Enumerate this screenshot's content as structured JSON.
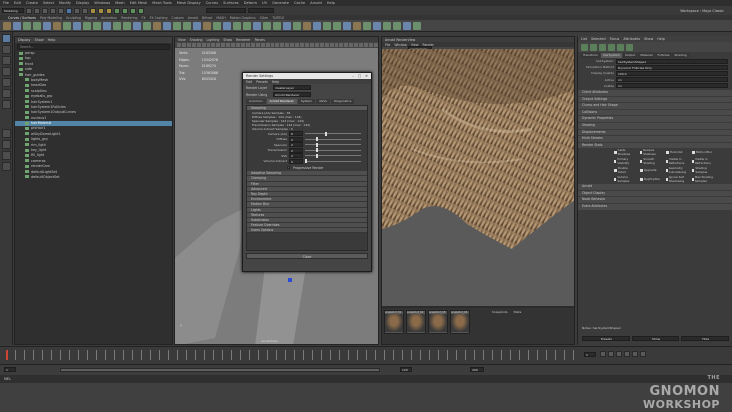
{
  "menubar": [
    "File",
    "Edit",
    "Create",
    "Select",
    "Modify",
    "Display",
    "Windows",
    "Mesh",
    "Edit Mesh",
    "Mesh Tools",
    "Mesh Display",
    "Curves",
    "Surfaces",
    "Deform",
    "UV",
    "Generate",
    "Cache",
    "Arnold",
    "Help"
  ],
  "workspace_label": "Workspace : Maya Classic",
  "shelf_tabs": [
    "Curves / Surfaces",
    "Poly Modeling",
    "Sculpting",
    "Rigging",
    "Animation",
    "Rendering",
    "FX",
    "FX Caching",
    "Custom",
    "Arnold",
    "Bifrost",
    "MASH",
    "Motion Graphics",
    "XGen",
    "TURTLE"
  ],
  "outliner": {
    "title": "Outliner",
    "menu": [
      "Display",
      "Show",
      "Help"
    ],
    "search_placeholder": "Search...",
    "items": [
      "persp",
      "top",
      "front",
      "side",
      "hair_guides",
      "bodyMesh",
      "headGeo",
      "scalpGeo",
      "eyeballs_grp",
      "hairSystem1",
      "hairSystem1Follicles",
      "hairSystem1OutputCurves",
      "nucleus1",
      "hairMaterial",
      "pfxHair1",
      "aiSkyDomeLight1",
      "lights_grp",
      "rim_light",
      "key_light",
      "fill_light",
      "cameras",
      "renderCam",
      "defaultLightSet",
      "defaultObjectSet"
    ],
    "selected_index": 13
  },
  "viewport": {
    "menu": [
      "View",
      "Shading",
      "Lighting",
      "Show",
      "Renderer",
      "Panels"
    ],
    "stats": [
      [
        "Verts:",
        "5183406"
      ],
      [
        "Edges:",
        "10342076"
      ],
      [
        "Faces:",
        "5189274"
      ],
      [
        "Tris:",
        "10363088"
      ],
      [
        "UVs:",
        "6043416"
      ]
    ],
    "label": "renderCam"
  },
  "render_settings": {
    "title": "Render Settings",
    "menu": [
      "Edit",
      "Presets",
      "Help"
    ],
    "render_layer_label": "Render Layer",
    "render_layer_value": "masterLayer",
    "render_using_label": "Render Using",
    "render_using_value": "Arnold Renderer",
    "tabs": [
      "Common",
      "Arnold Renderer",
      "System",
      "AOVs",
      "Diagnostics"
    ],
    "active_tab": 1,
    "sampling_header": "Sampling",
    "sample_lines": [
      "Camera (AA) Samples : 36",
      "Diffuse Samples : 144 (max : 144)",
      "Specular Samples : 144 (max : 144)",
      "Transmission Samples : 144 (max : 144)",
      "Volume Indirect Samples : 0"
    ],
    "sliders": [
      {
        "label": "Camera (AA)",
        "value": "6",
        "pct": 0.35
      },
      {
        "label": "Diffuse",
        "value": "2",
        "pct": 0.2
      },
      {
        "label": "Specular",
        "value": "2",
        "pct": 0.2
      },
      {
        "label": "Transmission",
        "value": "2",
        "pct": 0.2
      },
      {
        "label": "SSS",
        "value": "2",
        "pct": 0.2
      },
      {
        "label": "Volume Indirect",
        "value": "0",
        "pct": 0.0
      }
    ],
    "progressive_label": "Progressive Render",
    "sections": [
      "Adaptive Sampling",
      "Clamping",
      "Filter",
      "Advanced",
      "Ray Depth",
      "Environment",
      "Motion Blur",
      "Lights",
      "Textures",
      "Subdivision",
      "Feature Overrides",
      "Users Options"
    ],
    "close_label": "Close"
  },
  "render_view": {
    "title": "Arnold RenderView",
    "menu": [
      "File",
      "Window",
      "View",
      "Render"
    ],
    "camera_label": "renderCam",
    "thumbs": [
      "snapshot_01",
      "snapshot_02",
      "snapshot_03",
      "snapshot_04"
    ],
    "tabs": [
      "Snapshots",
      "Stats"
    ]
  },
  "attribute_editor": {
    "menu": [
      "List",
      "Selected",
      "Focus",
      "Attributes",
      "Show",
      "Help"
    ],
    "tabs": [
      "Transform",
      "hairSystem",
      "Output",
      "Material",
      "Follicles",
      "Shading"
    ],
    "active_tab": 1,
    "node_label": "hairSystemShape1",
    "presets_label": "Presets",
    "show_label": "Show",
    "hide_label": "Hide",
    "fields": [
      {
        "label": "Simulation Method",
        "value": "Dynamic Follicles Only"
      },
      {
        "label": "Display Quality",
        "value": "100.0"
      },
      {
        "label": "Active",
        "value": "on"
      },
      {
        "label": "Collide",
        "value": "on"
      }
    ],
    "sections": [
      "Client Attributes",
      "Output Settings",
      "Clump and Hair Shape",
      "Collisions",
      "Dynamic Properties",
      "Shading",
      "Displacements",
      "Multi Streaks",
      "Render Stats",
      "Arnold",
      "Object Display",
      "Node Behavior",
      "Extra Attributes"
    ],
    "checkboxes": [
      "Casts Shadows",
      "Receive Shadows",
      "Hold-Out",
      "Motion Blur",
      "Primary Visibility",
      "Smooth Shading",
      "Visible In Reflections",
      "Visible In Refractions",
      "Double Sided",
      "Opposite",
      "Geometry Anti-aliasing",
      "Shading Samples",
      "Volume Samples",
      "Depth Jitter",
      "Ignore Self Shadowing",
      "Max Shading Samples"
    ],
    "notes": "Notes: hairSystemShape1"
  },
  "timeline": {
    "start": "1",
    "end": "120",
    "current": "1",
    "range_start": "1",
    "range_end": "200"
  },
  "command_line": "MEL",
  "brand": {
    "line1": "THE",
    "line2": "GNOMON",
    "line3": "WORKSHOP"
  }
}
